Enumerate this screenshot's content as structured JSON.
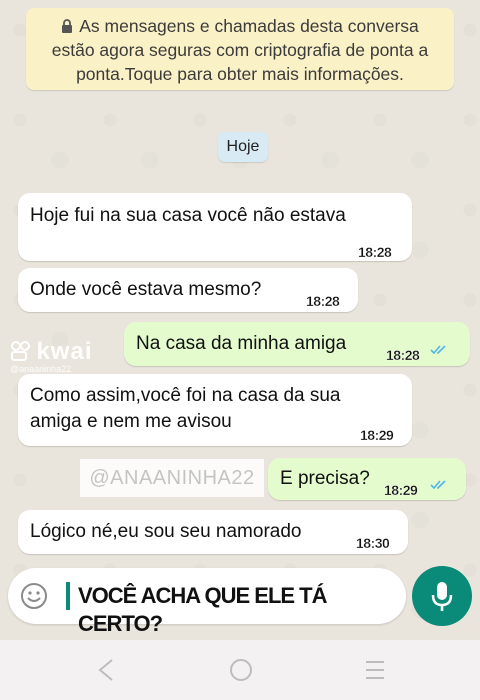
{
  "system_notice": {
    "line1": "As mensagens e chamadas desta conversa",
    "line2": "estão agora seguras com criptografia de ponta a",
    "line3": "ponta.Toque para obter mais informações."
  },
  "date_chip": "Hoje",
  "messages": [
    {
      "dir": "in",
      "lines": [
        "Hoje fui na sua casa você não estava"
      ],
      "time": "18:28"
    },
    {
      "dir": "in",
      "lines": [
        "Onde você estava mesmo?"
      ],
      "time": "18:28"
    },
    {
      "dir": "out",
      "lines": [
        "Na casa da minha amiga"
      ],
      "time": "18:28",
      "status": "read"
    },
    {
      "dir": "in",
      "lines": [
        "Como assim,você foi na casa da sua",
        "amiga e nem me avisou"
      ],
      "time": "18:29"
    },
    {
      "dir": "out",
      "lines": [
        "E precisa?"
      ],
      "time": "18:29",
      "status": "read"
    },
    {
      "dir": "in",
      "lines": [
        "Lógico né,eu sou seu namorado"
      ],
      "time": "18:30"
    }
  ],
  "watermarks": {
    "kwai_logo": "kwai",
    "kwai_handle": "@anaaninha22",
    "overlay_handle": "@ANAANINHA22"
  },
  "composer": {
    "text": "VOCÊ ACHA QUE ELE TÁ CERTO?",
    "emoji_icon": "emoji-icon",
    "mic_icon": "microphone-icon"
  },
  "nav": {
    "back_icon": "back-icon",
    "home_icon": "home-icon",
    "recents_icon": "recents-icon"
  },
  "colors": {
    "incoming_bubble": "#ffffff",
    "outgoing_bubble": "#e4fbcd",
    "accent": "#0a8a78",
    "read_ticks": "#4fb6ec",
    "notice_bg": "#fbf1c6"
  }
}
